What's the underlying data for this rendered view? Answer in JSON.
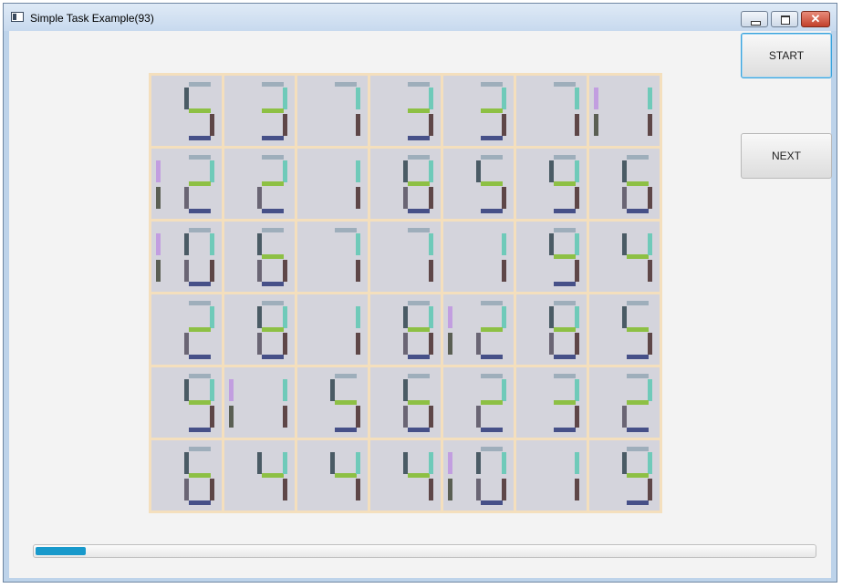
{
  "window": {
    "title": "Simple Task Example(93)"
  },
  "buttons": {
    "start_label": "START",
    "next_label": "NEXT"
  },
  "progress": {
    "fraction": 0.065,
    "color": "#1899cb"
  },
  "grid": {
    "rows": [
      [
        "5",
        "3",
        "7",
        "3",
        "3",
        "7",
        "11"
      ],
      [
        "12",
        "2",
        "1",
        "8",
        "5",
        "9",
        "6"
      ],
      [
        "10",
        "6",
        "7",
        "7",
        "1",
        "9",
        "4"
      ],
      [
        "2",
        "8",
        "1",
        "8",
        "12",
        "8",
        "5"
      ],
      [
        "9",
        "11",
        "5",
        "6",
        "2",
        "3",
        "2"
      ],
      [
        "6",
        "4",
        "4",
        "4",
        "10",
        "1",
        "9"
      ]
    ]
  },
  "colors": {
    "cell_background": "#d4d4dc",
    "grid_border": "#f4dfbd",
    "segment_top": "#9eaebb",
    "segment_top_left": "#4a5b65",
    "segment_top_right": "#6fcab9",
    "segment_middle": "#8dc044",
    "segment_bottom_left": "#6a6574",
    "segment_bottom_right": "#5e4647",
    "segment_bottom": "#465088",
    "prefix_one_top": "#c29ee0",
    "prefix_one_bottom": "#5a5f53"
  },
  "icons": {
    "app": "app-window-icon",
    "minimize": "minimize-icon",
    "maximize": "maximize-icon",
    "close": "close-icon"
  }
}
